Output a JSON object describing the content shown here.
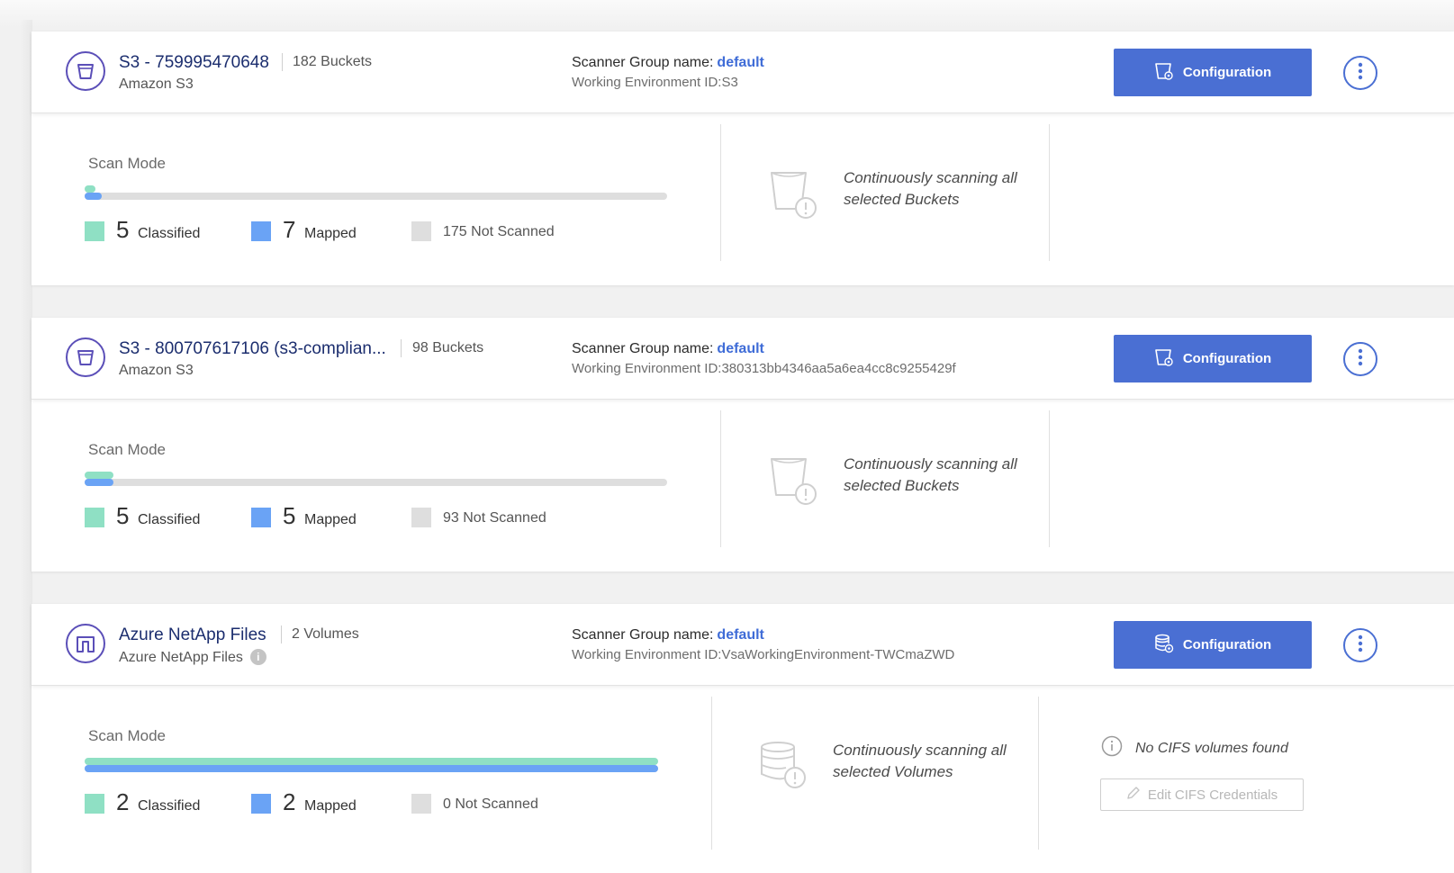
{
  "colors": {
    "accent": "#4a6fd3",
    "link": "#3f6cd7",
    "classified": "#8fe0c4",
    "mapped": "#6aa3f5",
    "not_scanned": "#dedede",
    "env_icon": "#5b4fb8"
  },
  "scan_mode_label": "Scan Mode",
  "scanner_group_label": "Scanner Group name:",
  "configuration_label": "Configuration",
  "environments": [
    {
      "name": "S3 - 759995470648",
      "count_label": "182 Buckets",
      "type": "Amazon S3",
      "icon": "bucket-icon",
      "scanner_group": "default",
      "working_env_id": "Working Environment ID:S3",
      "classified": {
        "count": "5",
        "label": "Classified"
      },
      "mapped": {
        "count": "7",
        "label": "Mapped"
      },
      "not_scanned": "175 Not Scanned",
      "progress": {
        "classified_fraction": 0.018,
        "mapped_fraction": 0.03
      },
      "scan_status": "Continuously scanning all selected Buckets"
    },
    {
      "name": "S3 - 800707617106 (s3-complian...",
      "count_label": "98 Buckets",
      "type": "Amazon S3",
      "icon": "bucket-icon",
      "scanner_group": "default",
      "working_env_id": "Working Environment ID:380313bb4346aa5a6ea4cc8c9255429f",
      "classified": {
        "count": "5",
        "label": "Classified"
      },
      "mapped": {
        "count": "5",
        "label": "Mapped"
      },
      "not_scanned": "93 Not Scanned",
      "progress": {
        "classified_fraction": 0.05,
        "mapped_fraction": 0.05
      },
      "scan_status": "Continuously scanning all selected Buckets"
    },
    {
      "name": "Azure NetApp Files",
      "count_label": "2 Volumes",
      "type": "Azure NetApp Files",
      "icon": "netapp-files-icon",
      "scanner_group": "default",
      "working_env_id": "Working Environment ID:VsaWorkingEnvironment-TWCmaZWD",
      "classified": {
        "count": "2",
        "label": "Classified"
      },
      "mapped": {
        "count": "2",
        "label": "Mapped"
      },
      "not_scanned": "0 Not Scanned",
      "progress": {
        "classified_fraction": 1.0,
        "mapped_fraction": 1.0
      },
      "scan_status": "Continuously scanning all selected Volumes",
      "cifs_message": "No CIFS volumes found",
      "cifs_button": "Edit CIFS Credentials"
    }
  ]
}
